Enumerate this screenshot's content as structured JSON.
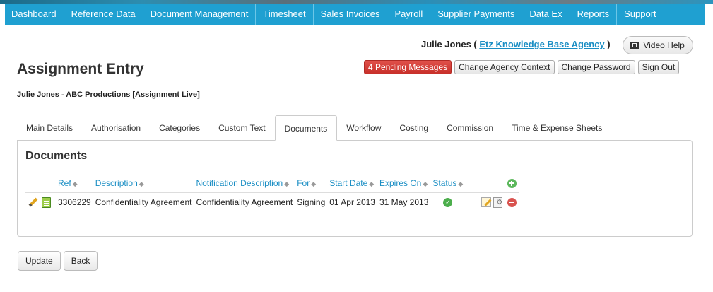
{
  "nav": {
    "items": [
      "Dashboard",
      "Reference Data",
      "Document Management",
      "Timesheet",
      "Sales Invoices",
      "Payroll",
      "Supplier Payments",
      "Data Ex",
      "Reports",
      "Support"
    ]
  },
  "user": {
    "name": "Julie Jones (",
    "agency": "Etz Knowledge Base Agency",
    "close": ")"
  },
  "video_help": "Video Help",
  "header": {
    "title": "Assignment Entry",
    "subtitle": "Julie Jones - ABC Productions [Assignment Live]",
    "buttons": {
      "pending": "4 Pending Messages",
      "change_agency": "Change Agency Context",
      "change_password": "Change Password",
      "sign_out": "Sign Out"
    }
  },
  "tabs": [
    "Main Details",
    "Authorisation",
    "Categories",
    "Custom Text",
    "Documents",
    "Workflow",
    "Costing",
    "Commission",
    "Time & Expense Sheets"
  ],
  "active_tab": "Documents",
  "documents": {
    "title": "Documents",
    "columns": {
      "ref": "Ref",
      "description": "Description",
      "notification": "Notification Description",
      "for": "For",
      "start": "Start Date",
      "expires": "Expires On",
      "status": "Status"
    },
    "row": {
      "ref": "3306229",
      "description": "Confidentiality Agreement",
      "notification": "Confidentiality Agreement",
      "for": "Signing",
      "start": "01 Apr 2013",
      "expires": "31 May 2013"
    }
  },
  "footer": {
    "update": "Update",
    "back": "Back"
  },
  "colors": {
    "nav_bg": "#1fa0d1",
    "link": "#1a8ec4",
    "pending_red": "#d9534f",
    "highlight": "#f2f21a"
  }
}
